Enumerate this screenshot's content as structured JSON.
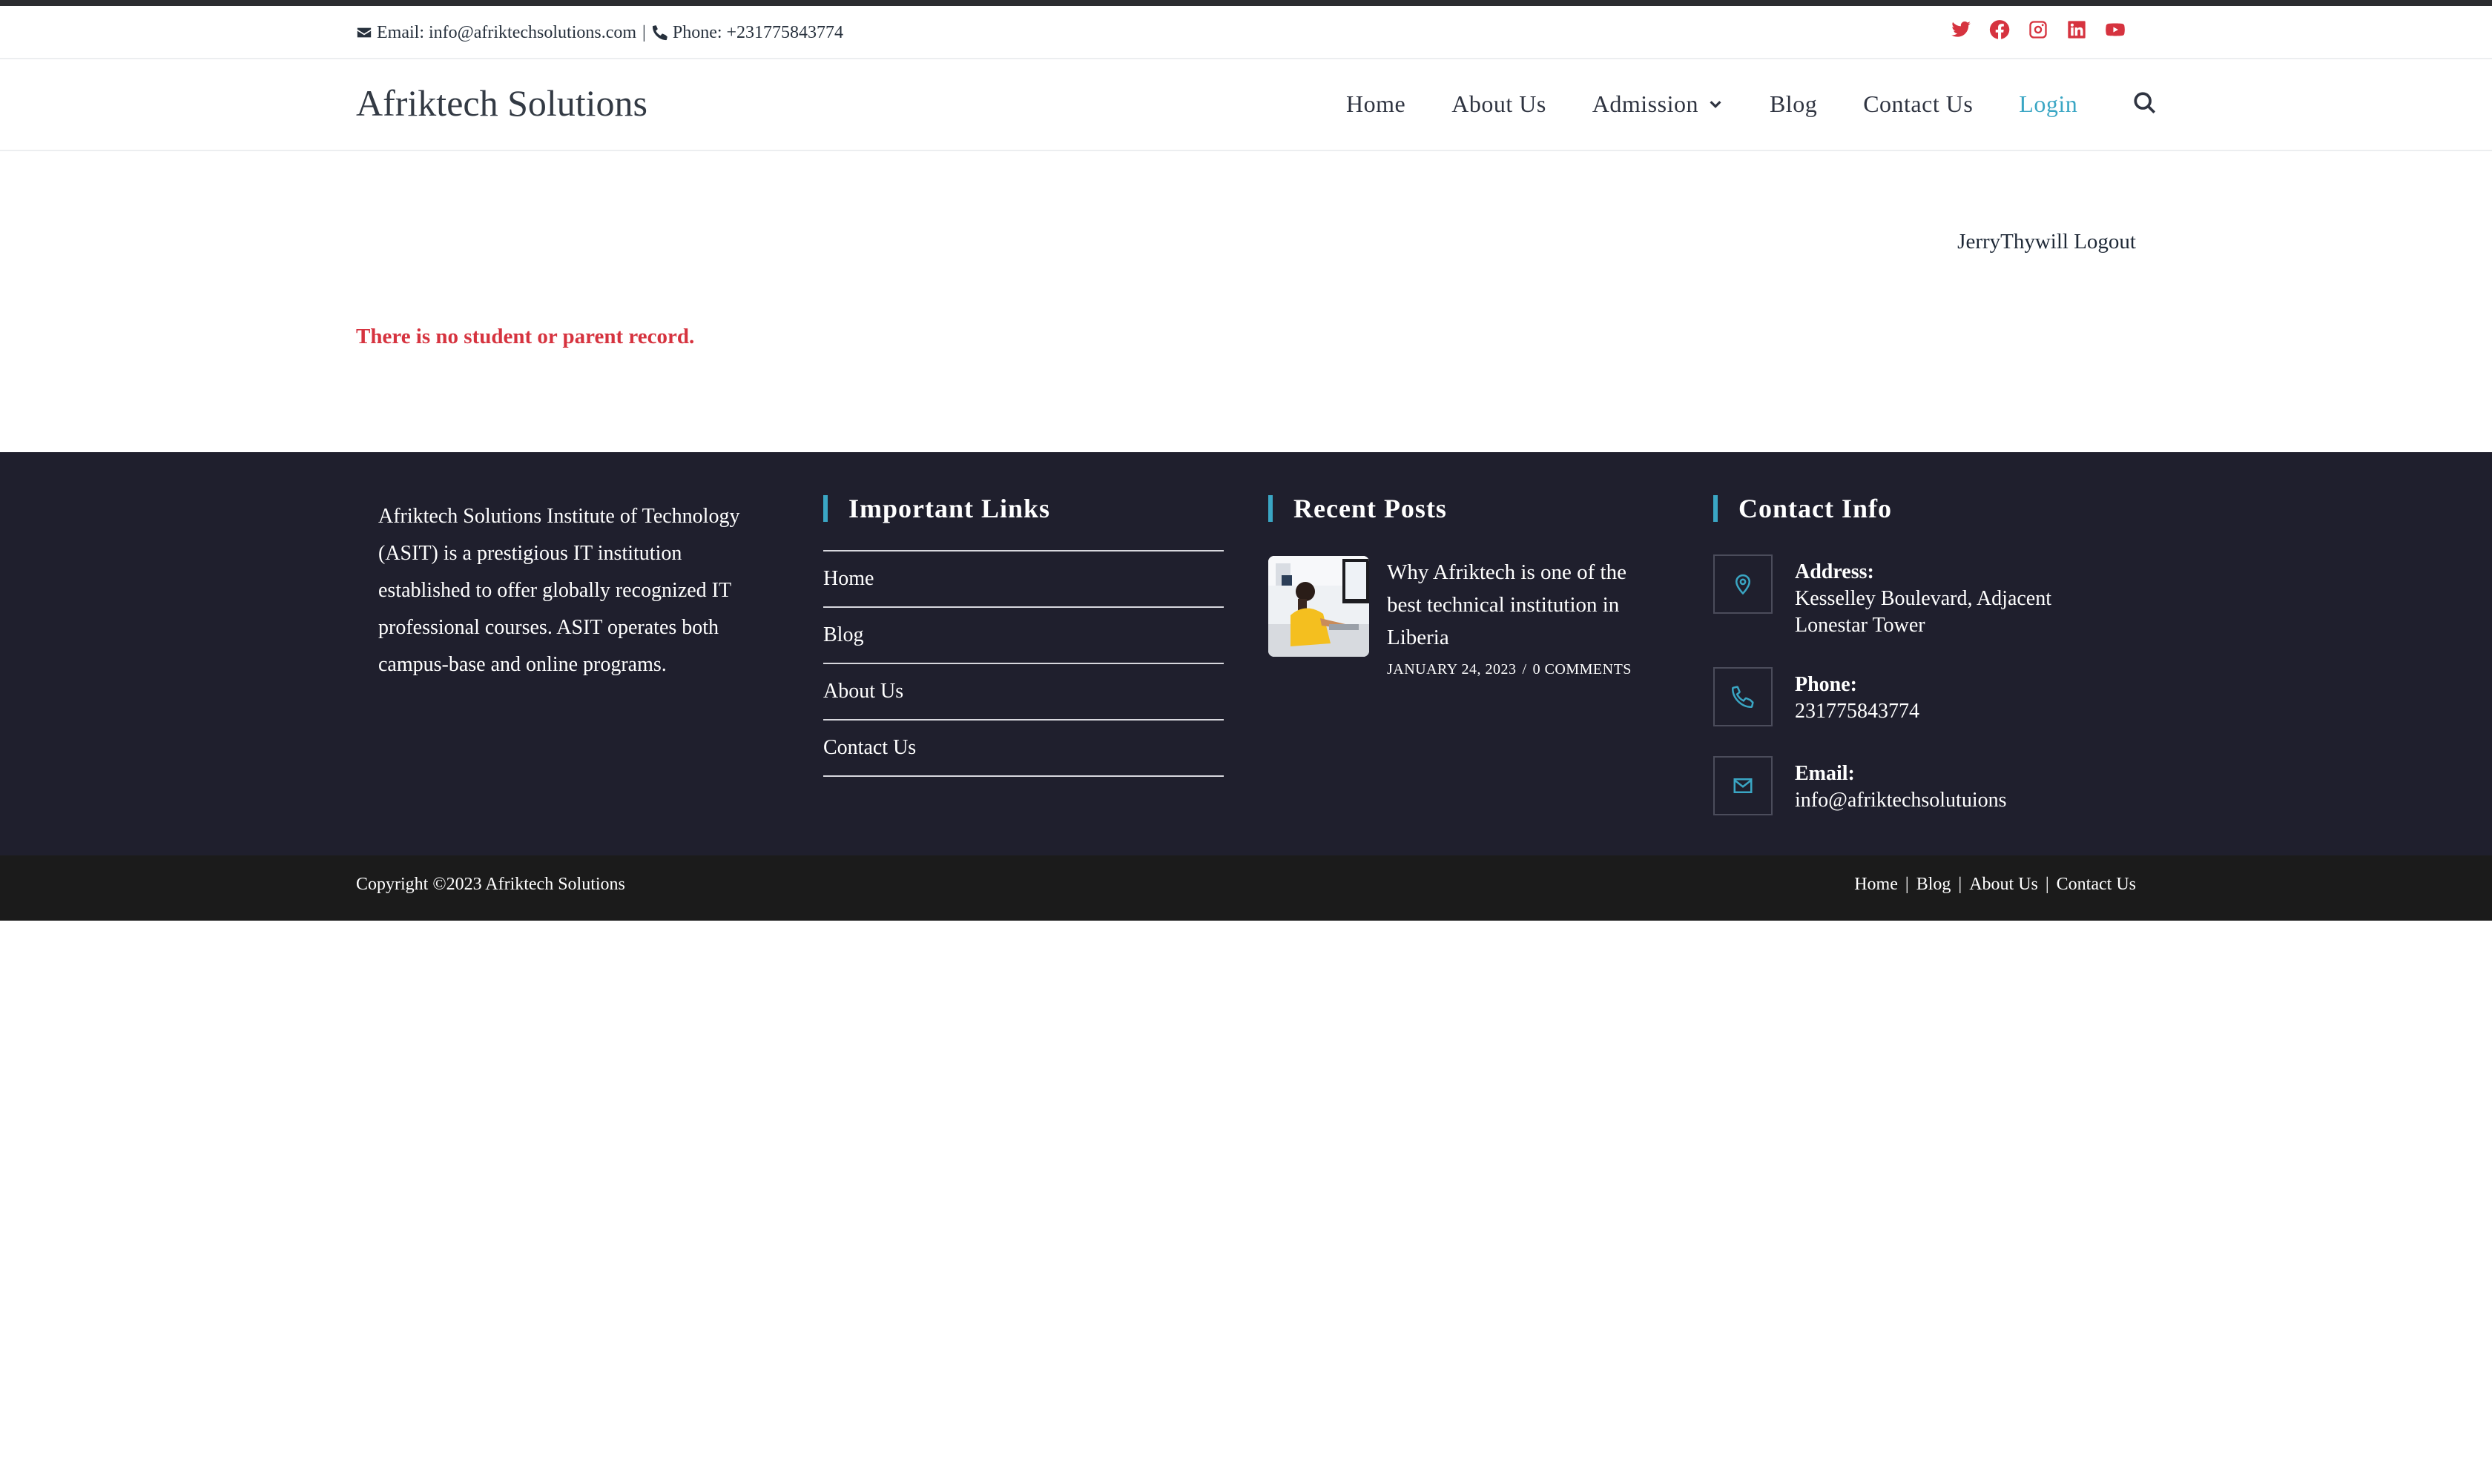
{
  "topbar": {
    "email_label": "Email:",
    "email": "info@afriktechsolutions.com",
    "separator": "|",
    "phone_label": "Phone:",
    "phone": "+231775843774",
    "social": [
      "twitter-icon",
      "facebook-icon",
      "instagram-icon",
      "linkedin-icon",
      "youtube-icon"
    ],
    "social_color": "#d6333f"
  },
  "header": {
    "brand": "Afriktech Solutions",
    "nav": {
      "home": "Home",
      "about": "About Us",
      "admission": "Admission",
      "blog": "Blog",
      "contact": "Contact Us",
      "login": "Login"
    },
    "accent_color": "#3aa6c4"
  },
  "main": {
    "username": "JerryThywill",
    "logout": "Logout",
    "notice": "There is no student or parent record.",
    "notice_color": "#d6333f"
  },
  "footer": {
    "about": "Afriktech Solutions Institute of Technology (ASIT) is a prestigious IT institution established to offer globally recognized IT professional courses. ASIT operates both campus-base and online programs.",
    "links_title": "Important Links",
    "links": [
      "Home",
      "Blog",
      "About Us",
      "Contact Us"
    ],
    "posts_title": "Recent Posts",
    "post": {
      "title": "Why Afriktech is one of the best technical institution in Liberia",
      "date": "JANUARY 24, 2023",
      "comments": "0 COMMENTS"
    },
    "contact_title": "Contact Info",
    "address_label": "Address:",
    "address": "Kesselley Boulevard, Adjacent Lonestar Tower",
    "phone_label": "Phone:",
    "phone": "231775843774",
    "email_label": "Email:",
    "email": "info@afriktechsolutuions",
    "background_color": "#1f1f2d"
  },
  "bottombar": {
    "copyright": "Copyright ©2023 Afriktech Solutions",
    "menu": [
      "Home",
      "Blog",
      "About Us",
      "Contact Us"
    ],
    "separator": "|"
  }
}
